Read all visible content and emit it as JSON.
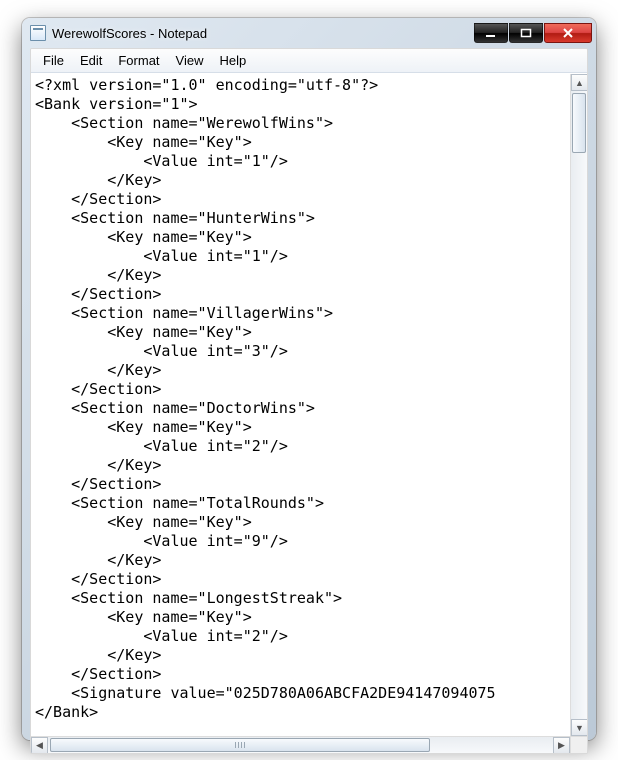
{
  "window": {
    "title": "WerewolfScores - Notepad"
  },
  "menu": {
    "file": "File",
    "edit": "Edit",
    "format": "Format",
    "view": "View",
    "help": "Help"
  },
  "document": {
    "lines": [
      "<?xml version=\"1.0\" encoding=\"utf-8\"?>",
      "<Bank version=\"1\">",
      "    <Section name=\"WerewolfWins\">",
      "        <Key name=\"Key\">",
      "            <Value int=\"1\"/>",
      "        </Key>",
      "    </Section>",
      "    <Section name=\"HunterWins\">",
      "        <Key name=\"Key\">",
      "            <Value int=\"1\"/>",
      "        </Key>",
      "    </Section>",
      "    <Section name=\"VillagerWins\">",
      "        <Key name=\"Key\">",
      "            <Value int=\"3\"/>",
      "        </Key>",
      "    </Section>",
      "    <Section name=\"DoctorWins\">",
      "        <Key name=\"Key\">",
      "            <Value int=\"2\"/>",
      "        </Key>",
      "    </Section>",
      "    <Section name=\"TotalRounds\">",
      "        <Key name=\"Key\">",
      "            <Value int=\"9\"/>",
      "        </Key>",
      "    </Section>",
      "    <Section name=\"LongestStreak\">",
      "        <Key name=\"Key\">",
      "            <Value int=\"2\"/>",
      "        </Key>",
      "    </Section>",
      "    <Signature value=\"025D780A06ABCFA2DE94147094075",
      "</Bank>"
    ]
  }
}
